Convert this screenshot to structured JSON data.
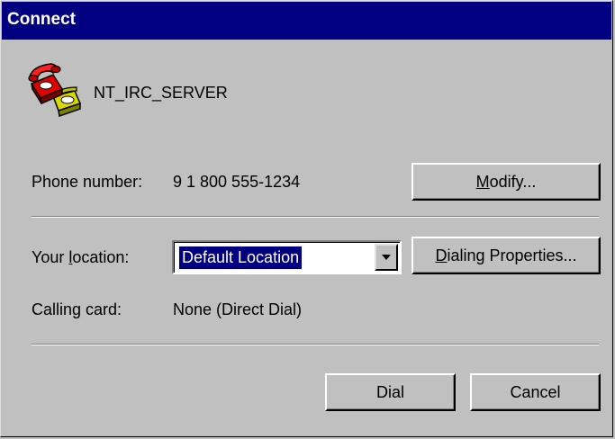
{
  "window": {
    "title": "Connect"
  },
  "connection": {
    "name": "NT_IRC_SERVER",
    "icon": "telephone-icon"
  },
  "phone": {
    "label": "Phone number:",
    "value": "9 1 800 555-1234",
    "modify_button": {
      "mnemonic": "M",
      "rest": "odify..."
    }
  },
  "location": {
    "label_prefix": "Your ",
    "label_mnemonic": "l",
    "label_rest": "ocation:",
    "selected": "Default Location",
    "dialing_button": {
      "mnemonic": "D",
      "rest": "ialing Properties..."
    }
  },
  "calling_card": {
    "label": "Calling card:",
    "value": "None (Direct Dial)"
  },
  "buttons": {
    "dial": "Dial",
    "cancel": "Cancel"
  },
  "colors": {
    "titlebar": "#000080",
    "face": "#c0c0c0",
    "selection": "#000080"
  }
}
